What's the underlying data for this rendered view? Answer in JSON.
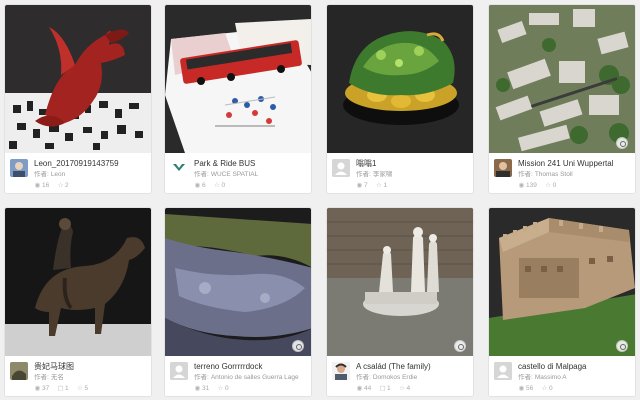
{
  "accent_color": "#4a90d9",
  "cards": [
    {
      "title": "Leon_20170919143759",
      "author_prefix": "作者:",
      "author": "Leon",
      "views": "16",
      "comments": "",
      "likes": "2",
      "icon_view": "eye-icon",
      "icon_like": "star-icon",
      "has_badge": false
    },
    {
      "title": "Park & Ride BUS",
      "author_prefix": "作者:",
      "author": "WUCE SPATIAL",
      "views": "6",
      "comments": "",
      "likes": "0",
      "icon_view": "eye-icon",
      "icon_like": "star-icon",
      "has_badge": false
    },
    {
      "title": "嗡嗡1",
      "author_prefix": "作者:",
      "author": "李家啸",
      "views": "7",
      "comments": "",
      "likes": "1",
      "icon_view": "eye-icon",
      "icon_like": "star-icon",
      "has_badge": false
    },
    {
      "title": "Mission 241 Uni Wuppertal",
      "author_prefix": "作者:",
      "author": "Thomas Stoll",
      "views": "139",
      "comments": "",
      "likes": "0",
      "icon_view": "eye-icon",
      "icon_like": "star-icon",
      "has_badge": true
    },
    {
      "title": "贵妃马球图",
      "author_prefix": "作者:",
      "author": "无名",
      "views": "37",
      "comments": "1",
      "likes": "5",
      "icon_view": "eye-icon",
      "icon_like": "star-icon",
      "has_badge": false
    },
    {
      "title": "terreno Gorrrrrdock",
      "author_prefix": "作者:",
      "author": "Antonio de salles Guerra Lage",
      "views": "31",
      "comments": "",
      "likes": "0",
      "icon_view": "eye-icon",
      "icon_like": "star-icon",
      "has_badge": true
    },
    {
      "title": "A család (The family)",
      "author_prefix": "作者:",
      "author": "Domokos Erdie",
      "views": "44",
      "comments": "1",
      "likes": "4",
      "icon_view": "eye-icon",
      "icon_like": "star-icon",
      "has_badge": true
    },
    {
      "title": "castello di Malpaga",
      "author_prefix": "作者:",
      "author": "Massimo A",
      "views": "56",
      "comments": "",
      "likes": "0",
      "icon_view": "eye-icon",
      "icon_like": "star-icon",
      "has_badge": true
    }
  ]
}
